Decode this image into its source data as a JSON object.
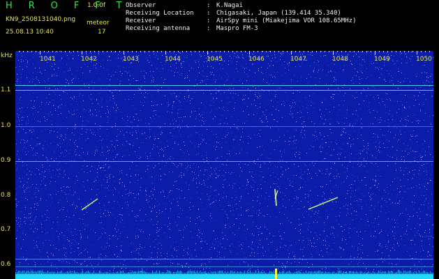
{
  "header": {
    "app_title": "H R O F F T",
    "app_version": "1.0.0f",
    "filename": "KN9_2508131040.png",
    "mode_label": "meteor",
    "timestamp": "25.08.13 10:40",
    "count_value": "17"
  },
  "info": [
    {
      "key": "Observer",
      "sep": ":",
      "value": "K.Nagai"
    },
    {
      "key": "Receiving Location",
      "sep": ":",
      "value": "Chigasaki, Japan (139.414 35.340)"
    },
    {
      "key": "Receiver",
      "sep": ":",
      "value": "AirSpy mini (Miakejima VOR 108.65MHz)"
    },
    {
      "key": "Receiving antenna",
      "sep": ":",
      "value": "Maspro FM-3"
    }
  ],
  "axes": {
    "y_unit": "kHz",
    "x_ticks": [
      "1041",
      "1042",
      "1043",
      "1044",
      "1045",
      "1046",
      "1047",
      "1048",
      "1049",
      "1050"
    ],
    "y_ticks": [
      "1.1",
      "1.0",
      "0.9",
      "0.8",
      "0.7",
      "0.6"
    ]
  },
  "colors": {
    "background": "#000000",
    "spectrogram_base": "#0b1ca8",
    "label_yellow": "#e6e64d",
    "title_green": "#33e54a",
    "signal_cyan": "#4fe6ff"
  }
}
